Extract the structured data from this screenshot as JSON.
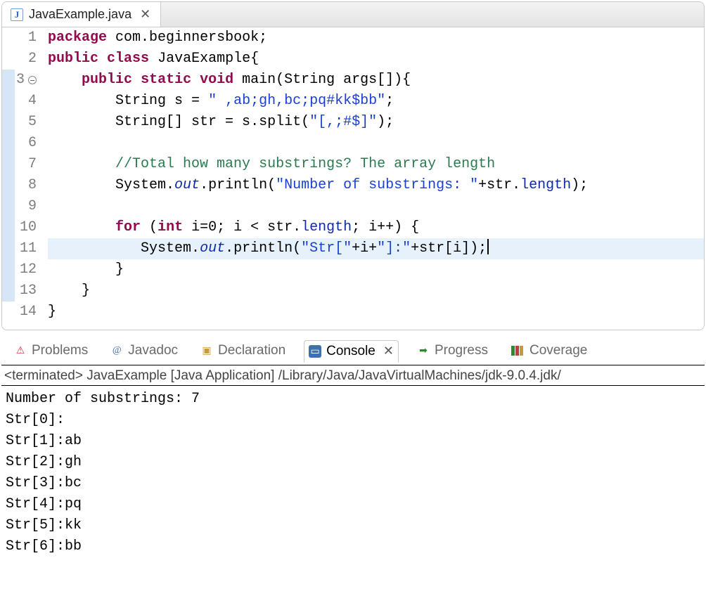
{
  "editor": {
    "tab": {
      "icon_letter": "J",
      "filename": "JavaExample.java",
      "close": "✕"
    },
    "lines": [
      {
        "num": "1",
        "marker": "",
        "fold": "",
        "hl": false,
        "tokens": [
          [
            "kw",
            "package"
          ],
          [
            "plain",
            " "
          ],
          [
            "pkg",
            "com.beginnersbook"
          ],
          [
            "plain",
            ";"
          ]
        ]
      },
      {
        "num": "2",
        "marker": "",
        "fold": "",
        "hl": false,
        "tokens": [
          [
            "kw",
            "public"
          ],
          [
            "plain",
            " "
          ],
          [
            "kw",
            "class"
          ],
          [
            "plain",
            " JavaExample{"
          ]
        ]
      },
      {
        "num": "3",
        "marker": "bar",
        "fold": "minus",
        "hl": false,
        "tokens": [
          [
            "plain",
            "    "
          ],
          [
            "kw",
            "public"
          ],
          [
            "plain",
            " "
          ],
          [
            "kw",
            "static"
          ],
          [
            "plain",
            " "
          ],
          [
            "kw",
            "void"
          ],
          [
            "plain",
            " main(String args[]){"
          ]
        ]
      },
      {
        "num": "4",
        "marker": "bar",
        "fold": "",
        "hl": false,
        "tokens": [
          [
            "plain",
            "        String s = "
          ],
          [
            "str",
            "\" ,ab;gh,bc;pq#kk$bb\""
          ],
          [
            "plain",
            ";"
          ]
        ]
      },
      {
        "num": "5",
        "marker": "bar",
        "fold": "",
        "hl": false,
        "tokens": [
          [
            "plain",
            "        String[] str = s.split("
          ],
          [
            "str",
            "\"[,;#$]\""
          ],
          [
            "plain",
            ");"
          ]
        ]
      },
      {
        "num": "6",
        "marker": "bar",
        "fold": "",
        "hl": false,
        "tokens": [
          [
            "plain",
            ""
          ]
        ]
      },
      {
        "num": "7",
        "marker": "bar",
        "fold": "",
        "hl": false,
        "tokens": [
          [
            "plain",
            "        "
          ],
          [
            "cmt",
            "//Total how many substrings? The array length"
          ]
        ]
      },
      {
        "num": "8",
        "marker": "bar",
        "fold": "",
        "hl": false,
        "tokens": [
          [
            "plain",
            "        System."
          ],
          [
            "fld",
            "out"
          ],
          [
            "plain",
            ".println("
          ],
          [
            "str",
            "\"Number of substrings: \""
          ],
          [
            "plain",
            "+str."
          ],
          [
            "mem",
            "length"
          ],
          [
            "plain",
            ");"
          ]
        ]
      },
      {
        "num": "9",
        "marker": "bar",
        "fold": "",
        "hl": false,
        "tokens": [
          [
            "plain",
            ""
          ]
        ]
      },
      {
        "num": "10",
        "marker": "bar",
        "fold": "",
        "hl": false,
        "tokens": [
          [
            "plain",
            "        "
          ],
          [
            "kw",
            "for"
          ],
          [
            "plain",
            " ("
          ],
          [
            "kw",
            "int"
          ],
          [
            "plain",
            " i=0; i < str."
          ],
          [
            "mem",
            "length"
          ],
          [
            "plain",
            "; i++) {"
          ]
        ]
      },
      {
        "num": "11",
        "marker": "bar",
        "fold": "",
        "hl": true,
        "tokens": [
          [
            "plain",
            "           System."
          ],
          [
            "fld",
            "out"
          ],
          [
            "plain",
            ".println("
          ],
          [
            "str",
            "\"Str[\""
          ],
          [
            "plain",
            "+i+"
          ],
          [
            "str",
            "\"]:\""
          ],
          [
            "plain",
            "+str[i]);"
          ]
        ]
      },
      {
        "num": "12",
        "marker": "bar",
        "fold": "",
        "hl": false,
        "tokens": [
          [
            "plain",
            "        }"
          ]
        ]
      },
      {
        "num": "13",
        "marker": "bar",
        "fold": "",
        "hl": false,
        "tokens": [
          [
            "plain",
            "    }"
          ]
        ]
      },
      {
        "num": "14",
        "marker": "",
        "fold": "",
        "hl": false,
        "tokens": [
          [
            "plain",
            "}"
          ]
        ]
      }
    ]
  },
  "views": {
    "tabs": [
      {
        "id": "problems",
        "label": "Problems",
        "active": false
      },
      {
        "id": "javadoc",
        "label": "Javadoc",
        "active": false
      },
      {
        "id": "decl",
        "label": "Declaration",
        "active": false
      },
      {
        "id": "console",
        "label": "Console",
        "active": true
      },
      {
        "id": "progress",
        "label": "Progress",
        "active": false
      },
      {
        "id": "coverage",
        "label": "Coverage",
        "active": false
      }
    ],
    "console_close": "✕"
  },
  "console": {
    "status": "<terminated> JavaExample [Java Application] /Library/Java/JavaVirtualMachines/jdk-9.0.4.jdk/",
    "output": [
      "Number of substrings: 7",
      "Str[0]:",
      "Str[1]:ab",
      "Str[2]:gh",
      "Str[3]:bc",
      "Str[4]:pq",
      "Str[5]:kk",
      "Str[6]:bb"
    ]
  }
}
